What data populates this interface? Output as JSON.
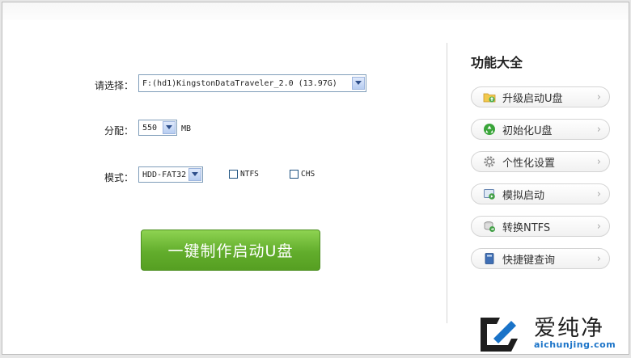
{
  "form": {
    "select_label": "请选择：",
    "device_value": "F:(hd1)KingstonDataTraveler_2.0 (13.97G)",
    "alloc_label": "分配：",
    "alloc_value": "550",
    "alloc_unit": "MB",
    "mode_label": "模式：",
    "mode_value": "HDD-FAT32",
    "ntfs_label": "NTFS",
    "ntfs_checked": false,
    "chs_label": "CHS",
    "chs_checked": false,
    "make_button": "一键制作启动U盘"
  },
  "panel": {
    "title": "功能大全",
    "items": [
      {
        "label": "升级启动U盘",
        "icon": "folder-upgrade-icon"
      },
      {
        "label": "初始化U盘",
        "icon": "recycle-icon"
      },
      {
        "label": "个性化设置",
        "icon": "gear-icon"
      },
      {
        "label": "模拟启动",
        "icon": "simulate-icon"
      },
      {
        "label": "转换NTFS",
        "icon": "convert-icon"
      },
      {
        "label": "快捷键查询",
        "icon": "book-icon"
      }
    ]
  },
  "watermark": {
    "text": "爱纯净",
    "url": "aichunjing.com"
  },
  "colors": {
    "button_green": "#62ad2c",
    "select_border": "#7f9db9",
    "watermark_blue": "#1a73c8"
  }
}
